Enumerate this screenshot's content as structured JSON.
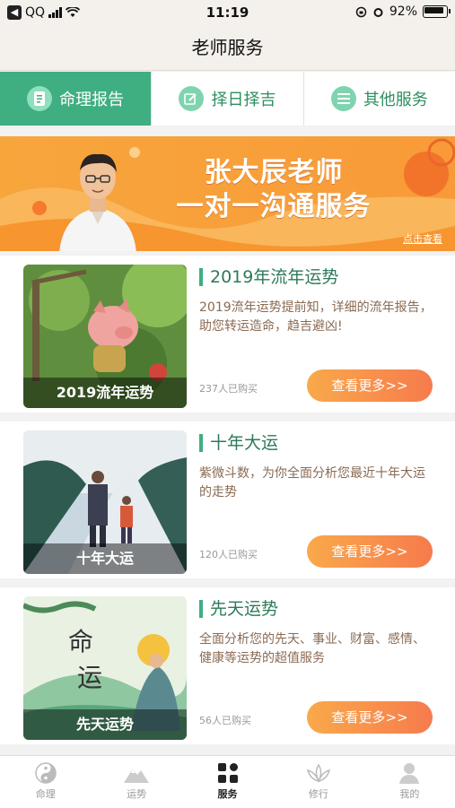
{
  "status": {
    "app": "QQ",
    "time": "11:19",
    "battery": "92%"
  },
  "navbar": {
    "title": "老师服务"
  },
  "tabs": [
    {
      "label": "命理报告",
      "icon": "document-icon"
    },
    {
      "label": "择日择吉",
      "icon": "edit-icon"
    },
    {
      "label": "其他服务",
      "icon": "list-icon"
    }
  ],
  "banner": {
    "title_line1": "张大辰老师",
    "title_line2": "一对一沟通服务",
    "link": "点击查看"
  },
  "cards": [
    {
      "title": "2019年流年运势",
      "desc": "2019流年运势提前知，详细的流年报告，助您转运造命，趋吉避凶!",
      "sold": "237人已购买",
      "button": "查看更多>>",
      "caption": "2019流年运势"
    },
    {
      "title": "十年大运",
      "desc": "紫微斗数，为你全面分析您最近十年大运的走势",
      "sold": "120人已购买",
      "button": "查看更多>>",
      "caption": "十年大运"
    },
    {
      "title": "先天运势",
      "desc": "全面分析您的先天、事业、财富、感情、健康等运势的超值服务",
      "sold": "56人已购买",
      "button": "查看更多>>",
      "caption": "先天运势",
      "art_text_1": "命",
      "art_text_2": "运"
    }
  ],
  "bottom_nav": [
    {
      "label": "命理",
      "icon": "yin-yang-icon"
    },
    {
      "label": "运势",
      "icon": "mountain-icon"
    },
    {
      "label": "服务",
      "icon": "grid-icon"
    },
    {
      "label": "修行",
      "icon": "lotus-icon"
    },
    {
      "label": "我的",
      "icon": "person-icon"
    }
  ],
  "colors": {
    "accent": "#3fae80",
    "button_start": "#f9a94a",
    "button_end": "#f67b4d",
    "banner": "#f7a63c"
  }
}
